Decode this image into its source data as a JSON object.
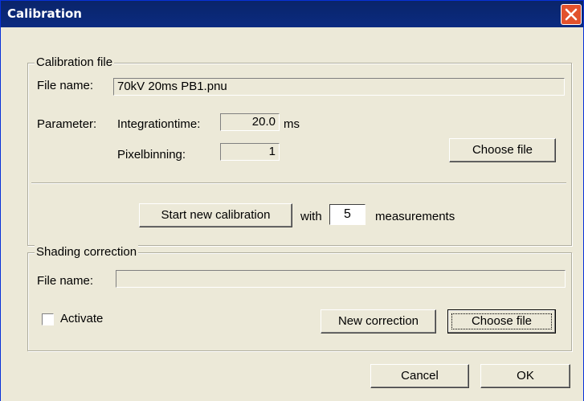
{
  "window": {
    "title": "Calibration"
  },
  "calibration_file": {
    "legend": "Calibration file",
    "file_name_label": "File name:",
    "file_name_value": "70kV 20ms PB1.pnu",
    "parameter_label": "Parameter:",
    "integrationtime_label": "Integrationtime:",
    "integrationtime_value": "20.0",
    "integrationtime_unit": "ms",
    "pixelbinning_label": "Pixelbinning:",
    "pixelbinning_value": "1",
    "choose_file_label": "Choose file",
    "start_button_label": "Start new calibration",
    "with_label": "with",
    "measurements_value": "5",
    "measurements_label": "measurements"
  },
  "shading_correction": {
    "legend": "Shading correction",
    "file_name_label": "File name:",
    "file_name_value": "",
    "activate_label": "Activate",
    "activate_checked": false,
    "new_correction_label": "New correction",
    "choose_file_label": "Choose file"
  },
  "footer": {
    "cancel_label": "Cancel",
    "ok_label": "OK"
  }
}
